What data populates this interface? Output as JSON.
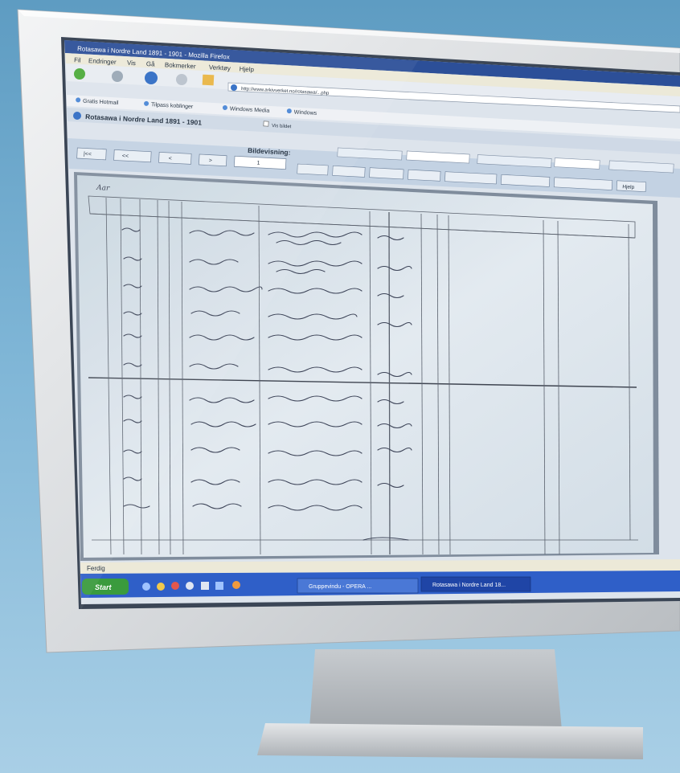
{
  "window": {
    "title": "Rotasawa i Nordre Land 1891 - 1901 - Mozilla Firefox"
  },
  "menu": {
    "items": [
      "Fil",
      "Endringer",
      "Vis",
      "Gå",
      "Bokmerker",
      "Verktøy",
      "Hjelp"
    ]
  },
  "address": {
    "url": "http://www.arkivverket.no/rotasawa/...php"
  },
  "bookmarks": {
    "items": [
      "Gratis Hotmail",
      "Tilpass koblinger",
      "Windows Media",
      "Windows"
    ]
  },
  "page": {
    "heading": "Rotasawa i Nordre Land 1891 - 1901",
    "checkbox_label": "Vis bildet"
  },
  "toolbar": {
    "label": "Bildevisning:",
    "nav_buttons": [
      "|<<",
      "<<",
      "<",
      ">",
      ">>",
      ">>|"
    ],
    "page_value": "1",
    "zoom_select": "",
    "action_buttons": [
      "",
      "",
      "",
      "",
      "",
      "",
      "",
      "",
      "Hjelp"
    ]
  },
  "document": {
    "page_label": "Aar"
  },
  "statusbar": {
    "text": "Ferdig"
  },
  "taskbar": {
    "start_label": "Start",
    "tasks": [
      "Gruppevindu - OPERA ...",
      "Rotasawa i Nordre Land 18..."
    ]
  },
  "colors": {
    "background": "#7eb5d6",
    "bezel": "#d9dcdf",
    "titlebar": "#2c4f98",
    "document": "#dfe7ee"
  }
}
